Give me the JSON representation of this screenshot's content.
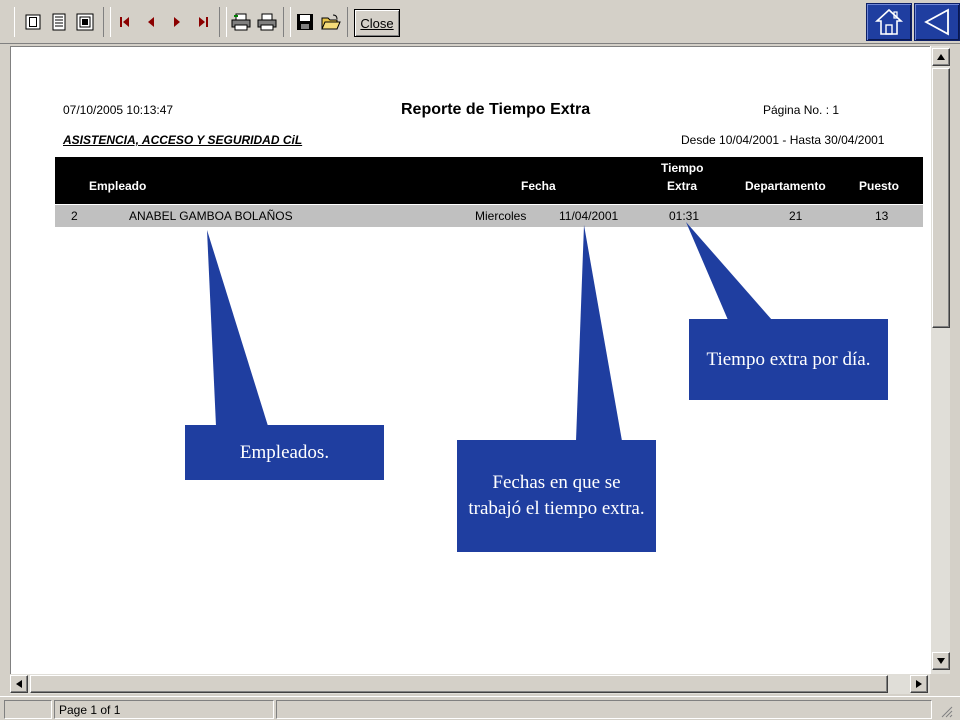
{
  "toolbar": {
    "buttons": [
      {
        "name": "single-page-view-icon"
      },
      {
        "name": "multi-page-view-icon"
      },
      {
        "name": "zoom-page-icon"
      },
      {
        "name": "first-page-icon"
      },
      {
        "name": "previous-page-icon"
      },
      {
        "name": "next-page-icon"
      },
      {
        "name": "last-page-icon"
      },
      {
        "name": "print-setup-icon"
      },
      {
        "name": "printer-icon"
      },
      {
        "name": "save-icon"
      },
      {
        "name": "open-folder-icon"
      }
    ],
    "close_label": "Close",
    "home_icon": "home-icon",
    "back_icon": "back-triangle-icon"
  },
  "report": {
    "timestamp": "07/10/2005 10:13:47",
    "title": "Reporte de Tiempo Extra",
    "page_label": "Página No. : 1",
    "company": "ASISTENCIA, ACCESO Y SEGURIDAD CiL",
    "date_range": "Desde 10/04/2001 - Hasta 30/04/2001",
    "columns": {
      "empleado": "Empleado",
      "fecha": "Fecha",
      "tiempo_extra_line1": "Tiempo",
      "tiempo_extra_line2": "Extra",
      "departamento": "Departamento",
      "puesto": "Puesto"
    },
    "rows": [
      {
        "id": "2",
        "name": "ANABEL GAMBOA BOLAÑOS",
        "day": "Miercoles",
        "date": "11/04/2001",
        "extra_time": "01:31",
        "department": "21",
        "position": "13"
      }
    ]
  },
  "callouts": {
    "empleados": "Empleados.",
    "fechas": "Fechas en que se trabajó el tiempo extra.",
    "tiempo": "Tiempo extra por día."
  },
  "status": {
    "page_info": "Page 1 of 1"
  },
  "colors": {
    "callout_bg": "#1f3ea0",
    "header_bg": "#000000",
    "row_bg": "#c0c0c0",
    "chrome": "#d4d0c8"
  }
}
